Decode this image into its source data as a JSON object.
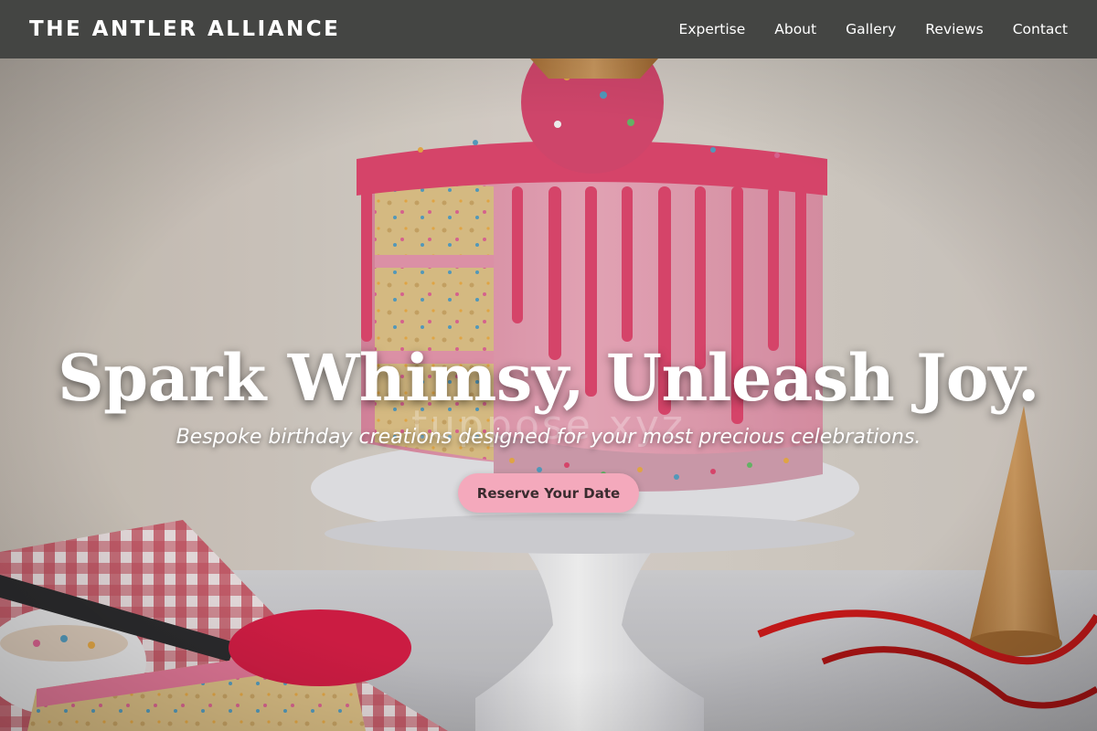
{
  "header": {
    "brand": "THE ANTLER ALLIANCE",
    "nav": [
      "Expertise",
      "About",
      "Gallery",
      "Reviews",
      "Contact"
    ]
  },
  "hero": {
    "title": "Spark Whimsy, Unleash Joy.",
    "subtitle": "Bespoke birthday creations designed for your most precious celebrations.",
    "cta_label": "Reserve Your Date",
    "watermark": "tuppose.xyz"
  },
  "colors": {
    "navbar": "#444543",
    "cta_bg": "#f4a9bc",
    "frosting": "#f0a3b6",
    "drip": "#e84a72"
  }
}
